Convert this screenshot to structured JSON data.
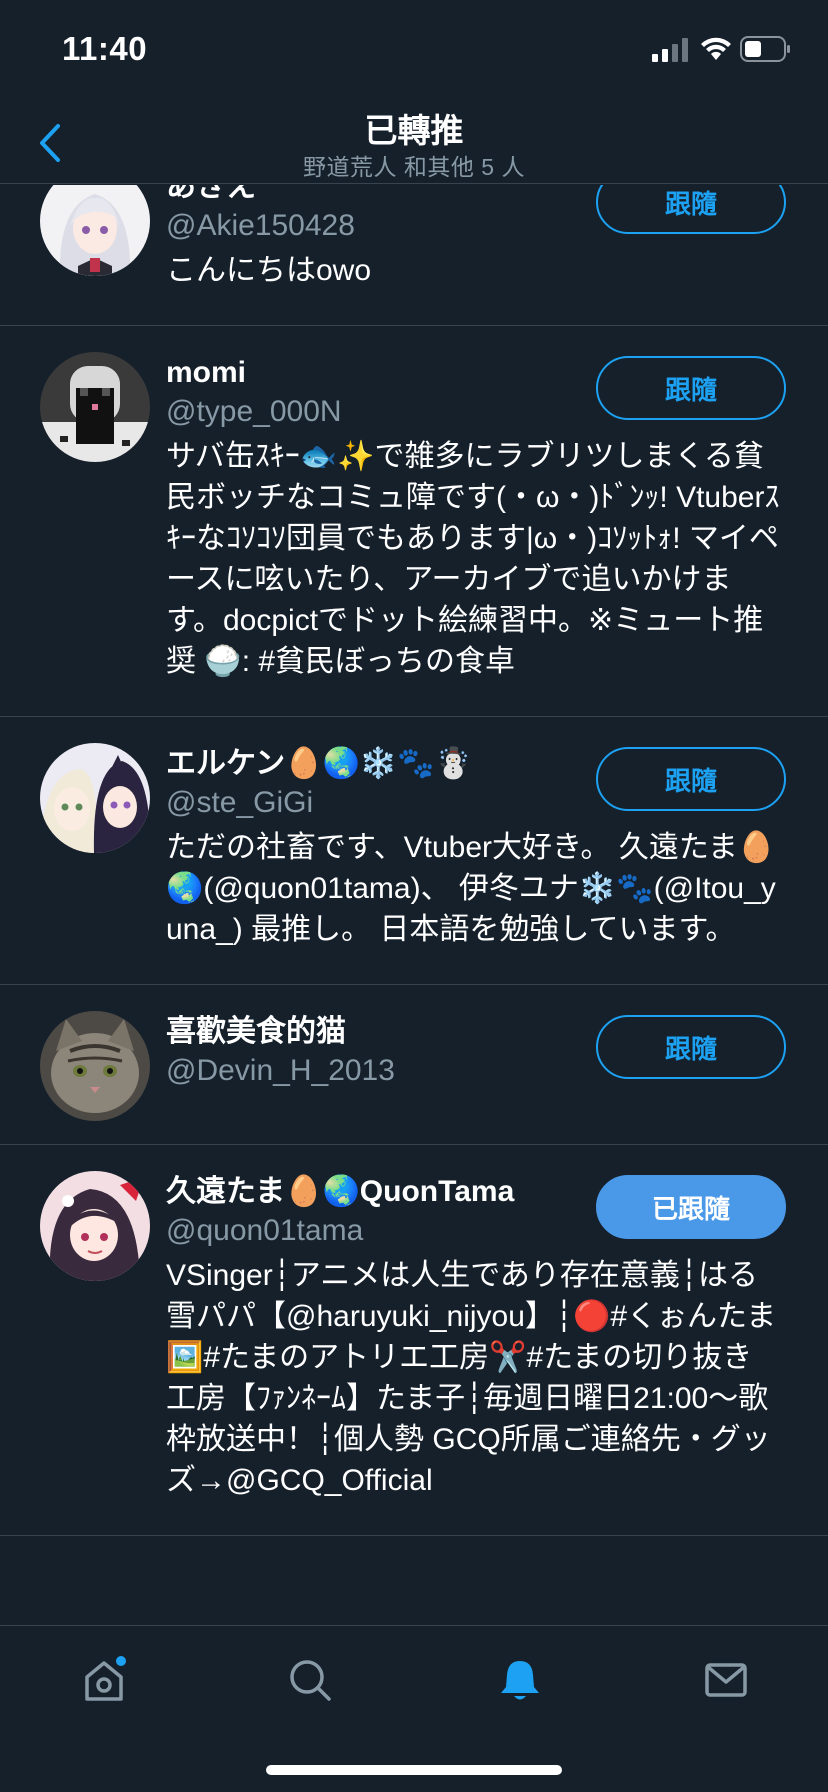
{
  "status_bar": {
    "time": "11:40"
  },
  "header": {
    "title": "已轉推",
    "subtitle": "野道荒人 和其他 5 人"
  },
  "users": [
    {
      "name": "あきえ",
      "handle": "@Akie150428",
      "bio": "こんにちはowo",
      "button": "跟隨"
    },
    {
      "name": "momi",
      "handle": "@type_000N",
      "bio": "サバ缶ｽｷｰ🐟✨で雑多にラブリツしまくる貧民ボッチなコミュ障です(・ω・)ﾄﾞﾝｯ! Vtuberｽｷｰなｺｿｺｿ団員でもあります|ω・)ｺｿｯﾄｫ! マイペースに呟いたり、アーカイブで追いかけます。docpictでドット絵練習中。※ミュート推奨 🍚: #貧民ぼっちの食卓",
      "button": "跟隨"
    },
    {
      "name": "エルケン🥚🌏❄️🐾☃️",
      "handle": "@ste_GiGi",
      "bio": "ただの社畜です、Vtuber大好き。 久遠たま🥚🌏(@quon01tama)、 伊冬ユナ❄️🐾(@Itou_yuna_) 最推し。 日本語を勉強しています。",
      "button": "跟隨"
    },
    {
      "name": "喜歡美食的猫",
      "handle": "@Devin_H_2013",
      "bio": "",
      "button": "跟隨"
    },
    {
      "name": "久遠たま🥚🌏QuonTama",
      "handle": "@quon01tama",
      "bio": "VSinger┆アニメは人生であり存在意義┆はる雪パパ【@haruyuki_nijyou】┆🔴#くぉんたま🖼️#たまのアトリエ工房✂️#たまの切り抜き工房【ﾌｧﾝﾈｰﾑ】たま子┆毎週日曜日21:00～歌枠放送中！┆個人勢 GCQ所属ご連絡先・グッズ→@GCQ_Official",
      "button": "已跟隨"
    }
  ],
  "tab_bar": {
    "items": [
      {
        "icon": "home-icon",
        "active": false,
        "has_dot": true
      },
      {
        "icon": "search-icon",
        "active": false
      },
      {
        "icon": "notifications-bell-icon",
        "active": true
      },
      {
        "icon": "messages-mail-icon",
        "active": false
      }
    ]
  },
  "colors": {
    "background": "#15202b",
    "accent": "#1da1f2",
    "muted_text": "#8899a6",
    "divider": "#38444d"
  }
}
